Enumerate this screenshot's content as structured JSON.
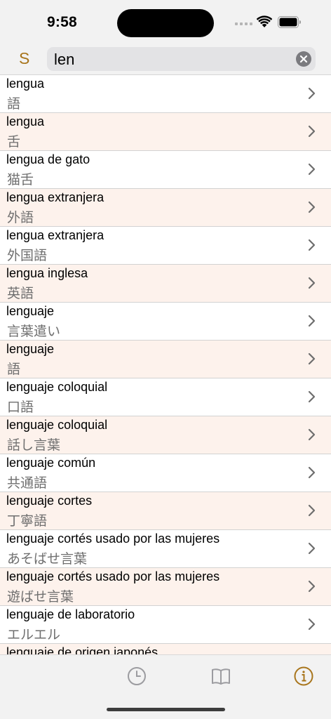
{
  "status": {
    "time": "9:58"
  },
  "header": {
    "s_label": "S",
    "search_value": "len",
    "accent": "#a8751c"
  },
  "results": [
    {
      "es": "lengua",
      "ja": "語"
    },
    {
      "es": "lengua",
      "ja": "舌"
    },
    {
      "es": "lengua de gato",
      "ja": "猫舌"
    },
    {
      "es": "lengua extranjera",
      "ja": "外語"
    },
    {
      "es": "lengua extranjera",
      "ja": "外国語"
    },
    {
      "es": "lengua inglesa",
      "ja": "英語"
    },
    {
      "es": "lenguaje",
      "ja": "言葉遣い"
    },
    {
      "es": "lenguaje",
      "ja": "語"
    },
    {
      "es": "lenguaje coloquial",
      "ja": "口語"
    },
    {
      "es": "lenguaje coloquial",
      "ja": "話し言葉"
    },
    {
      "es": "lenguaje común",
      "ja": "共通語"
    },
    {
      "es": "lenguaje cortes",
      "ja": "丁寧語"
    },
    {
      "es": "lenguaje cortés usado por las mujeres",
      "ja": "あそばせ言葉"
    },
    {
      "es": "lenguaje cortés usado por las mujeres",
      "ja": "遊ばせ言葉"
    },
    {
      "es": "lenguaje de laboratorio",
      "ja": "エルエル"
    },
    {
      "es": "lenguaje de origen japonés",
      "ja": ""
    }
  ],
  "tabs": [
    {
      "icon": "clock-icon",
      "selected": false
    },
    {
      "icon": "book-icon",
      "selected": false
    },
    {
      "icon": "info-icon",
      "selected": true
    }
  ]
}
